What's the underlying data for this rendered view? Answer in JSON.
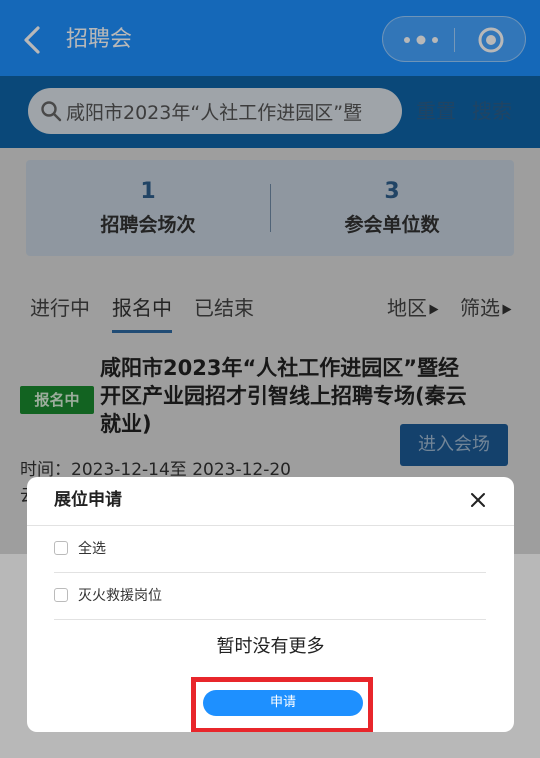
{
  "navbar": {
    "title": "招聘会",
    "back_icon": "chevron-left-icon",
    "more_icon": "more-dots-icon",
    "close_icon": "target-circle-icon"
  },
  "search": {
    "value": "咸阳市2023年“人社工作进园区”暨",
    "reset_label": "重置",
    "search_label": "搜索"
  },
  "stats": [
    {
      "value": "1",
      "label": "招聘会场次"
    },
    {
      "value": "3",
      "label": "参会单位数"
    }
  ],
  "tabs": [
    {
      "label": "进行中",
      "active": false
    },
    {
      "label": "报名中",
      "active": true
    },
    {
      "label": "已结束",
      "active": false
    }
  ],
  "filters": {
    "region": "地区",
    "screen": "筛选"
  },
  "job": {
    "badge": "报名中",
    "title": "咸阳市2023年“人社工作进园区”暨经开区产业园招才引智线上招聘专场(秦云就业)",
    "time_label": "时间：",
    "time_value": "2023-12-14至 2023-12-20",
    "second_line": "云",
    "enter_label": "进入会场"
  },
  "modal": {
    "title": "展位申请",
    "options": [
      {
        "label": "全选",
        "checked": false
      },
      {
        "label": "灭火救援岗位",
        "checked": false
      }
    ],
    "no_more": "暂时没有更多",
    "apply_label": "申请"
  },
  "colors": {
    "primary": "#1e90ff",
    "search_band": "#0f65a8",
    "badge": "#1a8a2e",
    "highlight": "#e8262b"
  }
}
